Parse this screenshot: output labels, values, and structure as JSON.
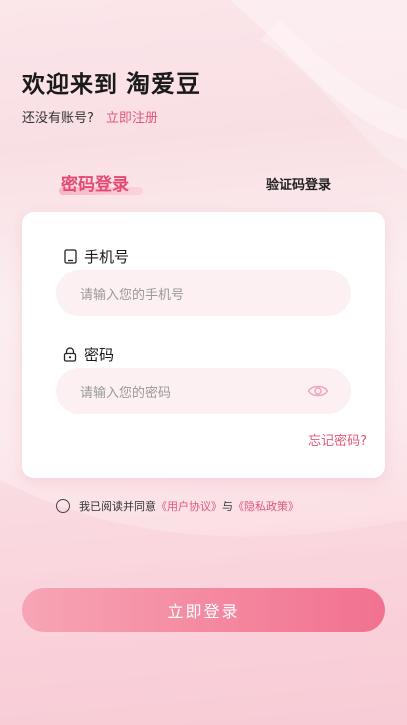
{
  "header": {
    "welcome": "欢迎来到",
    "brand": "淘爱豆",
    "no_account": "还没有账号?",
    "signup_link": "立即注册"
  },
  "tabs": {
    "password_login": "密码登录",
    "code_login": "验证码登录"
  },
  "form": {
    "phone_label": "手机号",
    "phone_placeholder": "请输入您的手机号",
    "password_label": "密码",
    "password_placeholder": "请输入您的密码",
    "forgot_password": "忘记密码?"
  },
  "agreement": {
    "prefix": "我已阅读并同意",
    "user_agreement": "《用户协议》",
    "and": "与",
    "privacy_policy": "《隐私政策》"
  },
  "login_button": "立即登录",
  "colors": {
    "accent": "#e0587a",
    "card_bg": "#ffffff",
    "input_bg": "#fdf0f2",
    "button_start": "#f7a5b6",
    "button_end": "#f27191"
  },
  "icons": {
    "phone": "phone-icon",
    "lock": "lock-icon",
    "eye": "eye-icon",
    "radio": "radio-unchecked-icon"
  }
}
